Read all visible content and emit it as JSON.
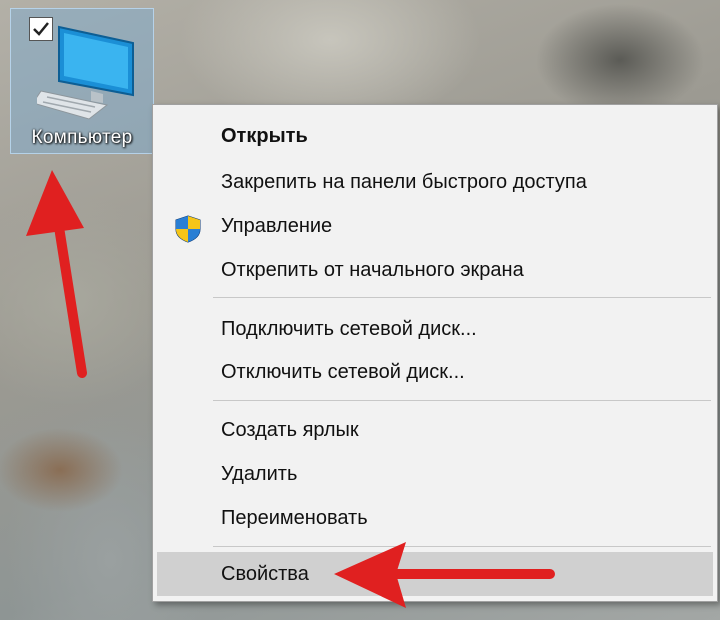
{
  "desktop": {
    "icon_label": "Компьютер",
    "icon_selected": true
  },
  "context_menu": {
    "groups": [
      {
        "items": [
          {
            "label": "Открыть",
            "bold": true
          },
          {
            "label": "Закрепить на панели быстрого доступа"
          },
          {
            "label": "Управление",
            "icon": "uac-shield-icon"
          },
          {
            "label": "Открепить от начального экрана"
          }
        ]
      },
      {
        "items": [
          {
            "label": "Подключить сетевой диск..."
          },
          {
            "label": "Отключить сетевой диск..."
          }
        ]
      },
      {
        "items": [
          {
            "label": "Создать ярлык"
          },
          {
            "label": "Удалить"
          },
          {
            "label": "Переименовать"
          }
        ]
      },
      {
        "items": [
          {
            "label": "Свойства",
            "highlighted": true
          }
        ]
      }
    ]
  },
  "annotations": {
    "arrow_color": "#e02020"
  }
}
